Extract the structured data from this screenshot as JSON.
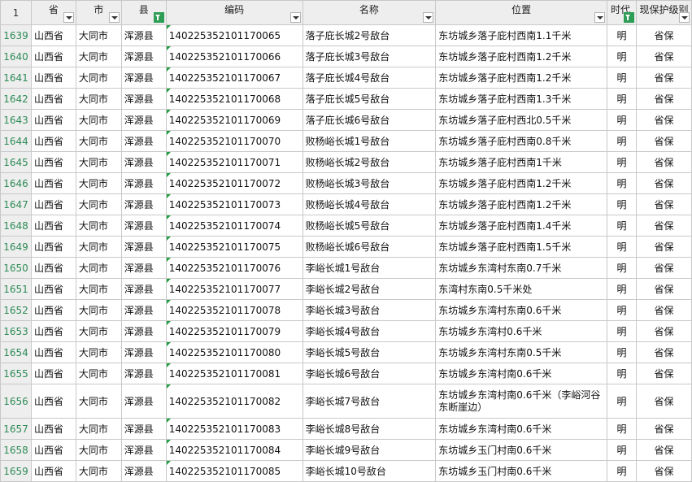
{
  "corner": "1",
  "headers": {
    "province": "省",
    "city": "市",
    "county": "县",
    "code": "编码",
    "name": "名称",
    "location": "位置",
    "era": "时代",
    "level": "现保护级别"
  },
  "rows": [
    {
      "num": "1639",
      "province": "山西省",
      "city": "大同市",
      "county": "浑源县",
      "code": "140225352101170065",
      "name": "落子庇长城2号敌台",
      "location": "东坊城乡落子庇村西南1.1千米",
      "era": "明",
      "level": "省保"
    },
    {
      "num": "1640",
      "province": "山西省",
      "city": "大同市",
      "county": "浑源县",
      "code": "140225352101170066",
      "name": "落子庇长城3号敌台",
      "location": "东坊城乡落子庇村西南1.2千米",
      "era": "明",
      "level": "省保"
    },
    {
      "num": "1641",
      "province": "山西省",
      "city": "大同市",
      "county": "浑源县",
      "code": "140225352101170067",
      "name": "落子庇长城4号敌台",
      "location": "东坊城乡落子庇村西南1.2千米",
      "era": "明",
      "level": "省保"
    },
    {
      "num": "1642",
      "province": "山西省",
      "city": "大同市",
      "county": "浑源县",
      "code": "140225352101170068",
      "name": "落子庇长城5号敌台",
      "location": "东坊城乡落子庇村西南1.3千米",
      "era": "明",
      "level": "省保"
    },
    {
      "num": "1643",
      "province": "山西省",
      "city": "大同市",
      "county": "浑源县",
      "code": "140225352101170069",
      "name": "落子庇长城6号敌台",
      "location": "东坊城乡落子庇村西北0.5千米",
      "era": "明",
      "level": "省保"
    },
    {
      "num": "1644",
      "province": "山西省",
      "city": "大同市",
      "county": "浑源县",
      "code": "140225352101170070",
      "name": "败杨峪长城1号敌台",
      "location": "东坊城乡落子庇村西南0.8千米",
      "era": "明",
      "level": "省保"
    },
    {
      "num": "1645",
      "province": "山西省",
      "city": "大同市",
      "county": "浑源县",
      "code": "140225352101170071",
      "name": "败杨峪长城2号敌台",
      "location": "东坊城乡落子庇村西南1千米",
      "era": "明",
      "level": "省保"
    },
    {
      "num": "1646",
      "province": "山西省",
      "city": "大同市",
      "county": "浑源县",
      "code": "140225352101170072",
      "name": "败杨峪长城3号敌台",
      "location": "东坊城乡落子庇村西南1.2千米",
      "era": "明",
      "level": "省保"
    },
    {
      "num": "1647",
      "province": "山西省",
      "city": "大同市",
      "county": "浑源县",
      "code": "140225352101170073",
      "name": "败杨峪长城4号敌台",
      "location": "东坊城乡落子庇村西南1.2千米",
      "era": "明",
      "level": "省保"
    },
    {
      "num": "1648",
      "province": "山西省",
      "city": "大同市",
      "county": "浑源县",
      "code": "140225352101170074",
      "name": "败杨峪长城5号敌台",
      "location": "东坊城乡落子庇村西南1.4千米",
      "era": "明",
      "level": "省保"
    },
    {
      "num": "1649",
      "province": "山西省",
      "city": "大同市",
      "county": "浑源县",
      "code": "140225352101170075",
      "name": "败杨峪长城6号敌台",
      "location": "东坊城乡落子庇村西南1.5千米",
      "era": "明",
      "level": "省保"
    },
    {
      "num": "1650",
      "province": "山西省",
      "city": "大同市",
      "county": "浑源县",
      "code": "140225352101170076",
      "name": "李峪长城1号敌台",
      "location": "东坊城乡东湾村东南0.7千米",
      "era": "明",
      "level": "省保"
    },
    {
      "num": "1651",
      "province": "山西省",
      "city": "大同市",
      "county": "浑源县",
      "code": "140225352101170077",
      "name": "李峪长城2号敌台",
      "location": "东湾村东南0.5千米处",
      "era": "明",
      "level": "省保"
    },
    {
      "num": "1652",
      "province": "山西省",
      "city": "大同市",
      "county": "浑源县",
      "code": "140225352101170078",
      "name": "李峪长城3号敌台",
      "location": "东坊城乡东湾村东南0.6千米",
      "era": "明",
      "level": "省保"
    },
    {
      "num": "1653",
      "province": "山西省",
      "city": "大同市",
      "county": "浑源县",
      "code": "140225352101170079",
      "name": "李峪长城4号敌台",
      "location": "东坊城乡东湾村0.6千米",
      "era": "明",
      "level": "省保"
    },
    {
      "num": "1654",
      "province": "山西省",
      "city": "大同市",
      "county": "浑源县",
      "code": "140225352101170080",
      "name": "李峪长城5号敌台",
      "location": "东坊城乡东湾村东南0.5千米",
      "era": "明",
      "level": "省保"
    },
    {
      "num": "1655",
      "province": "山西省",
      "city": "大同市",
      "county": "浑源县",
      "code": "140225352101170081",
      "name": "李峪长城6号敌台",
      "location": "东坊城乡东湾村南0.6千米",
      "era": "明",
      "level": "省保"
    },
    {
      "num": "1656",
      "province": "山西省",
      "city": "大同市",
      "county": "浑源县",
      "code": "140225352101170082",
      "name": "李峪长城7号敌台",
      "location": "东坊城乡东湾村南0.6千米（李峪河谷东断崖边）",
      "era": "明",
      "level": "省保"
    },
    {
      "num": "1657",
      "province": "山西省",
      "city": "大同市",
      "county": "浑源县",
      "code": "140225352101170083",
      "name": "李峪长城8号敌台",
      "location": "东坊城乡东湾村南0.6千米",
      "era": "明",
      "level": "省保"
    },
    {
      "num": "1658",
      "province": "山西省",
      "city": "大同市",
      "county": "浑源县",
      "code": "140225352101170084",
      "name": "李峪长城9号敌台",
      "location": "东坊城乡玉门村南0.6千米",
      "era": "明",
      "level": "省保"
    },
    {
      "num": "1659",
      "province": "山西省",
      "city": "大同市",
      "county": "浑源县",
      "code": "140225352101170085",
      "name": "李峪长城10号敌台",
      "location": "东坊城乡玉门村南0.6千米",
      "era": "明",
      "level": "省保"
    }
  ]
}
